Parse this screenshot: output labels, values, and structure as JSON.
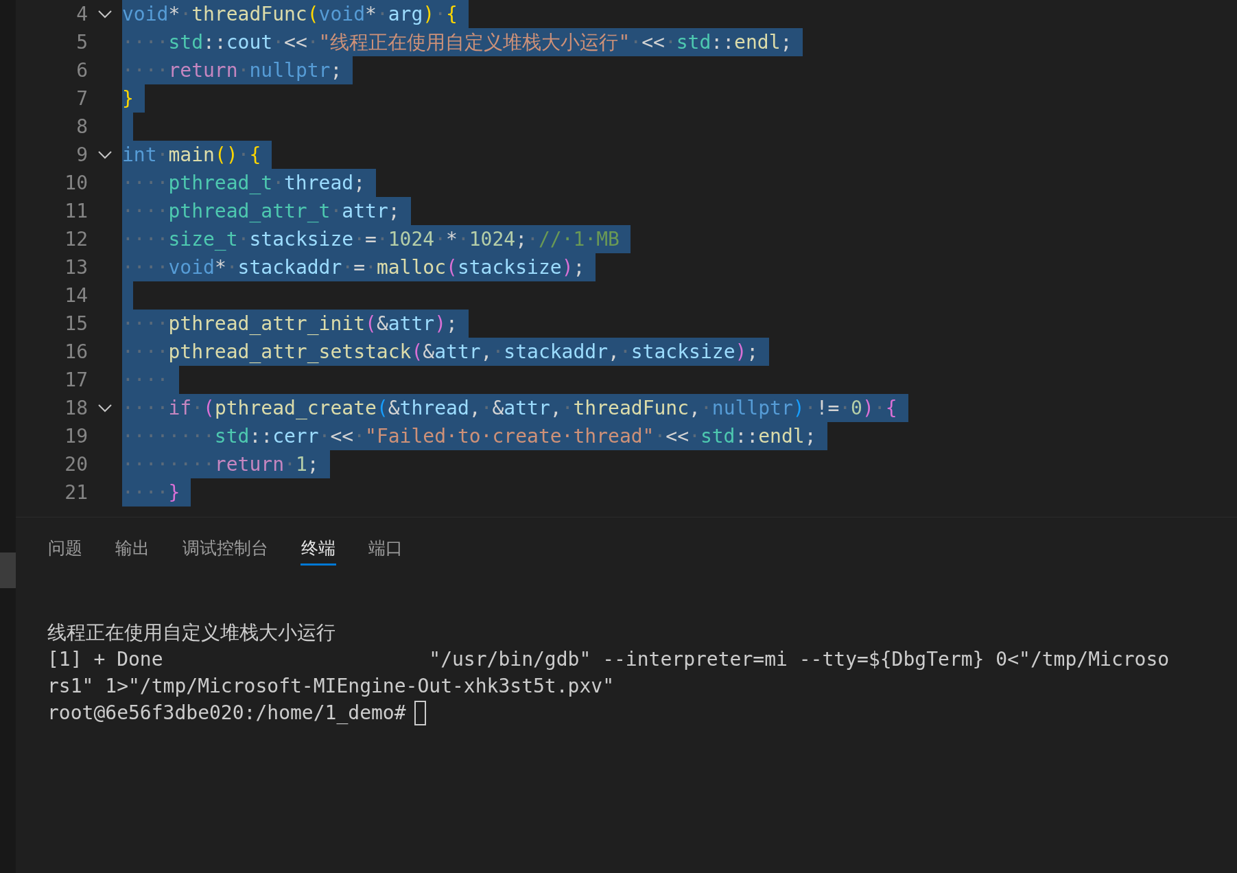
{
  "editor": {
    "lines": [
      {
        "number": "4",
        "collapsible": true,
        "selected": true,
        "tokens": [
          {
            "kind": "keyword",
            "text": "void"
          },
          {
            "kind": "op",
            "text": "*"
          },
          {
            "kind": "ws",
            "text": "·"
          },
          {
            "kind": "func",
            "text": "threadFunc"
          },
          {
            "kind": "bracket1",
            "text": "("
          },
          {
            "kind": "keyword",
            "text": "void"
          },
          {
            "kind": "op",
            "text": "*"
          },
          {
            "kind": "ws",
            "text": "·"
          },
          {
            "kind": "var",
            "text": "arg"
          },
          {
            "kind": "bracket1",
            "text": ")"
          },
          {
            "kind": "ws",
            "text": "·"
          },
          {
            "kind": "bracket1",
            "text": "{"
          }
        ]
      },
      {
        "number": "5",
        "collapsible": false,
        "selected": true,
        "tokens": [
          {
            "kind": "ws",
            "text": "····"
          },
          {
            "kind": "type",
            "text": "std"
          },
          {
            "kind": "op",
            "text": "::"
          },
          {
            "kind": "var",
            "text": "cout"
          },
          {
            "kind": "ws",
            "text": "·"
          },
          {
            "kind": "op",
            "text": "<<"
          },
          {
            "kind": "ws",
            "text": "·"
          },
          {
            "kind": "string",
            "text": "\"线程正在使用自定义堆栈大小运行\""
          },
          {
            "kind": "ws",
            "text": "·"
          },
          {
            "kind": "op",
            "text": "<<"
          },
          {
            "kind": "ws",
            "text": "·"
          },
          {
            "kind": "type",
            "text": "std"
          },
          {
            "kind": "op",
            "text": "::"
          },
          {
            "kind": "func",
            "text": "endl"
          },
          {
            "kind": "op",
            "text": ";"
          }
        ]
      },
      {
        "number": "6",
        "collapsible": false,
        "selected": true,
        "tokens": [
          {
            "kind": "ws",
            "text": "····"
          },
          {
            "kind": "control",
            "text": "return"
          },
          {
            "kind": "ws",
            "text": "·"
          },
          {
            "kind": "keyword",
            "text": "nullptr"
          },
          {
            "kind": "op",
            "text": ";"
          }
        ]
      },
      {
        "number": "7",
        "collapsible": false,
        "selected": true,
        "tokens": [
          {
            "kind": "bracket1",
            "text": "}"
          }
        ]
      },
      {
        "number": "8",
        "collapsible": false,
        "selected": true
      },
      {
        "number": "9",
        "collapsible": true,
        "selected": true,
        "tokens": [
          {
            "kind": "keyword",
            "text": "int"
          },
          {
            "kind": "ws",
            "text": "·"
          },
          {
            "kind": "func",
            "text": "main"
          },
          {
            "kind": "bracket1",
            "text": "()"
          },
          {
            "kind": "ws",
            "text": "·"
          },
          {
            "kind": "bracket1",
            "text": "{"
          }
        ]
      },
      {
        "number": "10",
        "collapsible": false,
        "selected": true,
        "tokens": [
          {
            "kind": "ws",
            "text": "····"
          },
          {
            "kind": "type",
            "text": "pthread_t"
          },
          {
            "kind": "ws",
            "text": "·"
          },
          {
            "kind": "var",
            "text": "thread"
          },
          {
            "kind": "op",
            "text": ";"
          }
        ]
      },
      {
        "number": "11",
        "collapsible": false,
        "selected": true,
        "tokens": [
          {
            "kind": "ws",
            "text": "····"
          },
          {
            "kind": "type",
            "text": "pthread_attr_t"
          },
          {
            "kind": "ws",
            "text": "·"
          },
          {
            "kind": "var",
            "text": "attr"
          },
          {
            "kind": "op",
            "text": ";"
          }
        ]
      },
      {
        "number": "12",
        "collapsible": false,
        "selected": true,
        "tokens": [
          {
            "kind": "ws",
            "text": "····"
          },
          {
            "kind": "type",
            "text": "size_t"
          },
          {
            "kind": "ws",
            "text": "·"
          },
          {
            "kind": "var",
            "text": "stacksize"
          },
          {
            "kind": "ws",
            "text": "·"
          },
          {
            "kind": "op",
            "text": "="
          },
          {
            "kind": "ws",
            "text": "·"
          },
          {
            "kind": "number",
            "text": "1024"
          },
          {
            "kind": "ws",
            "text": "·"
          },
          {
            "kind": "op",
            "text": "*"
          },
          {
            "kind": "ws",
            "text": "·"
          },
          {
            "kind": "number",
            "text": "1024"
          },
          {
            "kind": "op",
            "text": ";"
          },
          {
            "kind": "ws",
            "text": "·"
          },
          {
            "kind": "comment",
            "text": "//·1·MB"
          }
        ]
      },
      {
        "number": "13",
        "collapsible": false,
        "selected": true,
        "tokens": [
          {
            "kind": "ws",
            "text": "····"
          },
          {
            "kind": "keyword",
            "text": "void"
          },
          {
            "kind": "op",
            "text": "*"
          },
          {
            "kind": "ws",
            "text": "·"
          },
          {
            "kind": "var",
            "text": "stackaddr"
          },
          {
            "kind": "ws",
            "text": "·"
          },
          {
            "kind": "op",
            "text": "="
          },
          {
            "kind": "ws",
            "text": "·"
          },
          {
            "kind": "func",
            "text": "malloc"
          },
          {
            "kind": "bracket2",
            "text": "("
          },
          {
            "kind": "var",
            "text": "stacksize"
          },
          {
            "kind": "bracket2",
            "text": ")"
          },
          {
            "kind": "op",
            "text": ";"
          }
        ]
      },
      {
        "number": "14",
        "collapsible": false,
        "selected": true
      },
      {
        "number": "15",
        "collapsible": false,
        "selected": true,
        "tokens": [
          {
            "kind": "ws",
            "text": "····"
          },
          {
            "kind": "func",
            "text": "pthread_attr_init"
          },
          {
            "kind": "bracket2",
            "text": "("
          },
          {
            "kind": "op",
            "text": "&"
          },
          {
            "kind": "var",
            "text": "attr"
          },
          {
            "kind": "bracket2",
            "text": ")"
          },
          {
            "kind": "op",
            "text": ";"
          }
        ]
      },
      {
        "number": "16",
        "collapsible": false,
        "selected": true,
        "tokens": [
          {
            "kind": "ws",
            "text": "····"
          },
          {
            "kind": "func",
            "text": "pthread_attr_setstack"
          },
          {
            "kind": "bracket2",
            "text": "("
          },
          {
            "kind": "op",
            "text": "&"
          },
          {
            "kind": "var",
            "text": "attr"
          },
          {
            "kind": "op",
            "text": ","
          },
          {
            "kind": "ws",
            "text": "·"
          },
          {
            "kind": "var",
            "text": "stackaddr"
          },
          {
            "kind": "op",
            "text": ","
          },
          {
            "kind": "ws",
            "text": "·"
          },
          {
            "kind": "var",
            "text": "stacksize"
          },
          {
            "kind": "bracket2",
            "text": ")"
          },
          {
            "kind": "op",
            "text": ";"
          }
        ]
      },
      {
        "number": "17",
        "collapsible": false,
        "selected": true,
        "tokens": [
          {
            "kind": "ws",
            "text": "····"
          }
        ]
      },
      {
        "number": "18",
        "collapsible": true,
        "selected": true,
        "tokens": [
          {
            "kind": "ws",
            "text": "····"
          },
          {
            "kind": "control",
            "text": "if"
          },
          {
            "kind": "ws",
            "text": "·"
          },
          {
            "kind": "bracket2",
            "text": "("
          },
          {
            "kind": "func",
            "text": "pthread_create"
          },
          {
            "kind": "bracket3",
            "text": "("
          },
          {
            "kind": "op",
            "text": "&"
          },
          {
            "kind": "var",
            "text": "thread"
          },
          {
            "kind": "op",
            "text": ","
          },
          {
            "kind": "ws",
            "text": "·"
          },
          {
            "kind": "op",
            "text": "&"
          },
          {
            "kind": "var",
            "text": "attr"
          },
          {
            "kind": "op",
            "text": ","
          },
          {
            "kind": "ws",
            "text": "·"
          },
          {
            "kind": "func",
            "text": "threadFunc"
          },
          {
            "kind": "op",
            "text": ","
          },
          {
            "kind": "ws",
            "text": "·"
          },
          {
            "kind": "keyword",
            "text": "nullptr"
          },
          {
            "kind": "bracket3",
            "text": ")"
          },
          {
            "kind": "ws",
            "text": "·"
          },
          {
            "kind": "op",
            "text": "!="
          },
          {
            "kind": "ws",
            "text": "·"
          },
          {
            "kind": "number",
            "text": "0"
          },
          {
            "kind": "bracket2",
            "text": ")"
          },
          {
            "kind": "ws",
            "text": "·"
          },
          {
            "kind": "bracket2",
            "text": "{"
          }
        ]
      },
      {
        "number": "19",
        "collapsible": false,
        "selected": true,
        "tokens": [
          {
            "kind": "ws",
            "text": "········"
          },
          {
            "kind": "type",
            "text": "std"
          },
          {
            "kind": "op",
            "text": "::"
          },
          {
            "kind": "var",
            "text": "cerr"
          },
          {
            "kind": "ws",
            "text": "·"
          },
          {
            "kind": "op",
            "text": "<<"
          },
          {
            "kind": "ws",
            "text": "·"
          },
          {
            "kind": "string",
            "text": "\"Failed·to·create·thread\""
          },
          {
            "kind": "ws",
            "text": "·"
          },
          {
            "kind": "op",
            "text": "<<"
          },
          {
            "kind": "ws",
            "text": "·"
          },
          {
            "kind": "type",
            "text": "std"
          },
          {
            "kind": "op",
            "text": "::"
          },
          {
            "kind": "func",
            "text": "endl"
          },
          {
            "kind": "op",
            "text": ";"
          }
        ]
      },
      {
        "number": "20",
        "collapsible": false,
        "selected": true,
        "tokens": [
          {
            "kind": "ws",
            "text": "········"
          },
          {
            "kind": "control",
            "text": "return"
          },
          {
            "kind": "ws",
            "text": "·"
          },
          {
            "kind": "number",
            "text": "1"
          },
          {
            "kind": "op",
            "text": ";"
          }
        ]
      },
      {
        "number": "21",
        "collapsible": false,
        "selected": true,
        "tokens": [
          {
            "kind": "ws",
            "text": "····"
          },
          {
            "kind": "bracket2",
            "text": "}"
          }
        ]
      }
    ]
  },
  "panel": {
    "tabs": [
      {
        "label": "问题",
        "selected": false
      },
      {
        "label": "输出",
        "selected": false
      },
      {
        "label": "调试控制台",
        "selected": false
      },
      {
        "label": "终端",
        "selected": true
      },
      {
        "label": "端口",
        "selected": false
      }
    ],
    "terminal": {
      "lines": [
        "线程正在使用自定义堆栈大小运行",
        "[1] + Done                       \"/usr/bin/gdb\" --interpreter=mi --tty=${DbgTerm} 0<\"/tmp/Microso",
        "rs1\" 1>\"/tmp/Microsoft-MIEngine-Out-xhk3st5t.pxv\""
      ],
      "prompt": "root@6e56f3dbe020:/home/1_demo#"
    }
  }
}
